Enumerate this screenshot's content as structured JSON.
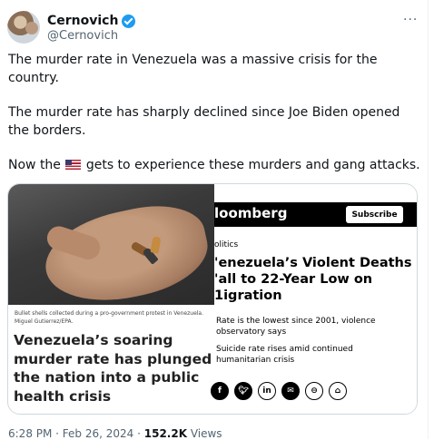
{
  "author": {
    "name": "Cernovich",
    "handle": "@Cernovich",
    "verified_color": "#1d9bf0"
  },
  "more_label": "···",
  "tweet": {
    "p1": "The murder rate in Venezuela was a massive crisis for the country.",
    "p2": "The murder rate has sharply declined since Joe Biden opened the borders.",
    "p3_before": "Now the",
    "p3_after": "gets to experience these murders and gang attacks."
  },
  "card": {
    "left": {
      "caption": "Bullet shells collected during a pro-government protest in Venezuela. Miguel Gutierrez/EPA.",
      "headline": "Venezuela’s soaring murder rate has plunged the nation into a public health crisis"
    },
    "right": {
      "brand": "loomberg",
      "subscribe": "Subscribe",
      "section": "olitics",
      "headline": "'enezuela’s Violent Deaths 'all to 22-Year Low on 1igration",
      "bullet1": "Rate is the lowest since 2001, violence observatory says",
      "bullet2": "Suicide rate rises amid continued humanitarian crisis",
      "share_icons": [
        "facebook-icon",
        "twitter-icon",
        "linkedin-icon",
        "email-icon",
        "link-icon",
        "gift-icon"
      ]
    }
  },
  "meta": {
    "time": "6:28 PM · Feb 26, 2024 · ",
    "views_count": "152.2K",
    "views_label": " Views"
  }
}
